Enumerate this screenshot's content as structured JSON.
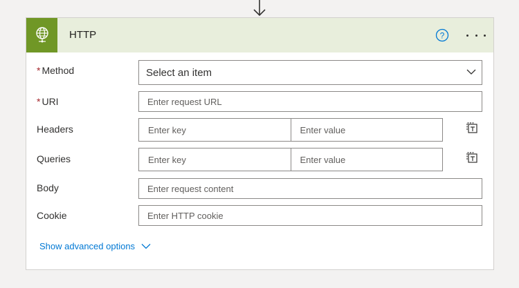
{
  "header": {
    "title": "HTTP",
    "icon": "globe-icon",
    "accent": "#709726",
    "header_bg": "#e8eedc"
  },
  "fields": {
    "method": {
      "label": "Method",
      "required_mark": "*",
      "placeholder": "Select an item"
    },
    "uri": {
      "label": "URI",
      "required_mark": "*",
      "placeholder": "Enter request URL"
    },
    "headers": {
      "label": "Headers",
      "key_placeholder": "Enter key",
      "value_placeholder": "Enter value"
    },
    "queries": {
      "label": "Queries",
      "key_placeholder": "Enter key",
      "value_placeholder": "Enter value"
    },
    "body": {
      "label": "Body",
      "placeholder": "Enter request content"
    },
    "cookie": {
      "label": "Cookie",
      "placeholder": "Enter HTTP cookie"
    }
  },
  "advanced": {
    "label": "Show advanced options"
  },
  "colors": {
    "link": "#0078d4",
    "required": "#a4262c"
  }
}
